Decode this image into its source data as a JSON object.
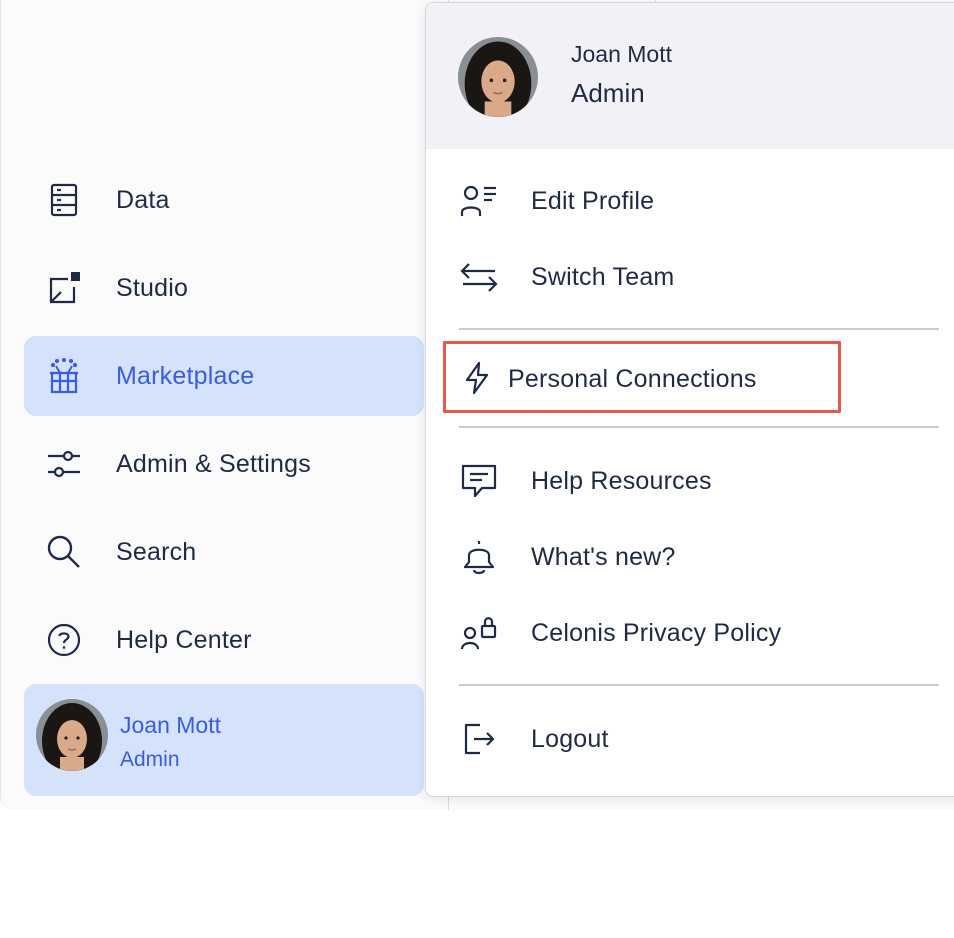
{
  "sidebar": {
    "items": [
      {
        "label": "Data",
        "icon": "database-icon"
      },
      {
        "label": "Studio",
        "icon": "studio-icon"
      },
      {
        "label": "Marketplace",
        "icon": "gift-box-icon",
        "active": true
      },
      {
        "label": "Admin & Settings",
        "icon": "sliders-icon"
      },
      {
        "label": "Search",
        "icon": "search-icon"
      },
      {
        "label": "Help Center",
        "icon": "question-circle-icon"
      }
    ],
    "user": {
      "name": "Joan Mott",
      "role": "Admin"
    }
  },
  "dropdown": {
    "header": {
      "name": "Joan Mott",
      "role": "Admin"
    },
    "items": [
      {
        "label": "Edit Profile",
        "icon": "edit-profile-icon"
      },
      {
        "label": "Switch Team",
        "icon": "switch-arrows-icon"
      },
      {
        "label": "Personal Connections",
        "icon": "lightning-icon",
        "highlighted": true
      },
      {
        "label": "Help Resources",
        "icon": "chat-bubble-icon"
      },
      {
        "label": "What's new?",
        "icon": "bell-icon"
      },
      {
        "label": "Celonis Privacy Policy",
        "icon": "user-lock-icon"
      },
      {
        "label": "Logout",
        "icon": "logout-icon"
      }
    ]
  },
  "colors": {
    "accent": "#3b5ce0",
    "active_bg": "#d4e2fb",
    "highlight_border": "#e9594b",
    "text": "#1f2a44"
  }
}
